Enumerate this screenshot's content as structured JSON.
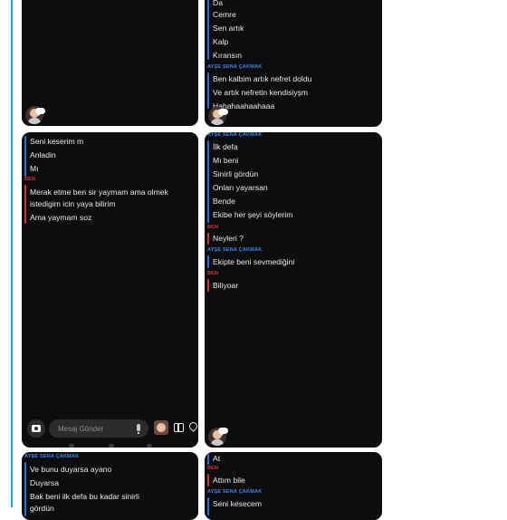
{
  "senders": {
    "ayse": "AYŞE SENA ÇAKMAK",
    "ben": "BEN"
  },
  "composer": {
    "placeholder": "Mesaj Gönder"
  },
  "p2_top": [
    "Da",
    "Cemre",
    "Sen artık",
    "Kalp",
    "Kıransın"
  ],
  "p2_ayse": [
    "Ben kalbim artık nefret doldu",
    "Ve artık nefretin kendisiyşm",
    "Hahahaahaahaaa"
  ],
  "p3": [
    "Seni keserim m",
    "Anladin",
    "Mı"
  ],
  "p3_ben": [
    "Merak etme ben sir yaymam ama olmek",
    "istedigim icin yaya bilirim",
    "Ama yaymam soz"
  ],
  "p4_ayse1": [
    "İlk defa",
    "Mı beni",
    "Sinirli gördün",
    "Onları yayarsan",
    "Bende",
    "Ekibe her şeyi söylerim"
  ],
  "p4_ben1": [
    "Neyleri ?"
  ],
  "p4_ayse2": [
    "Ekipte beni sevmediğini"
  ],
  "p4_ben2": [
    "Biliyoar"
  ],
  "p5_ayse": [
    "Ve bunu duyarsa ayano",
    "Duyarsa",
    "Bak beni ilk defa bu kadar sinirli",
    "gördün"
  ],
  "p6_top": [
    "At"
  ],
  "p6_ben": [
    "Attım bile"
  ],
  "p6_ayse": [
    "Seni kesecem"
  ]
}
